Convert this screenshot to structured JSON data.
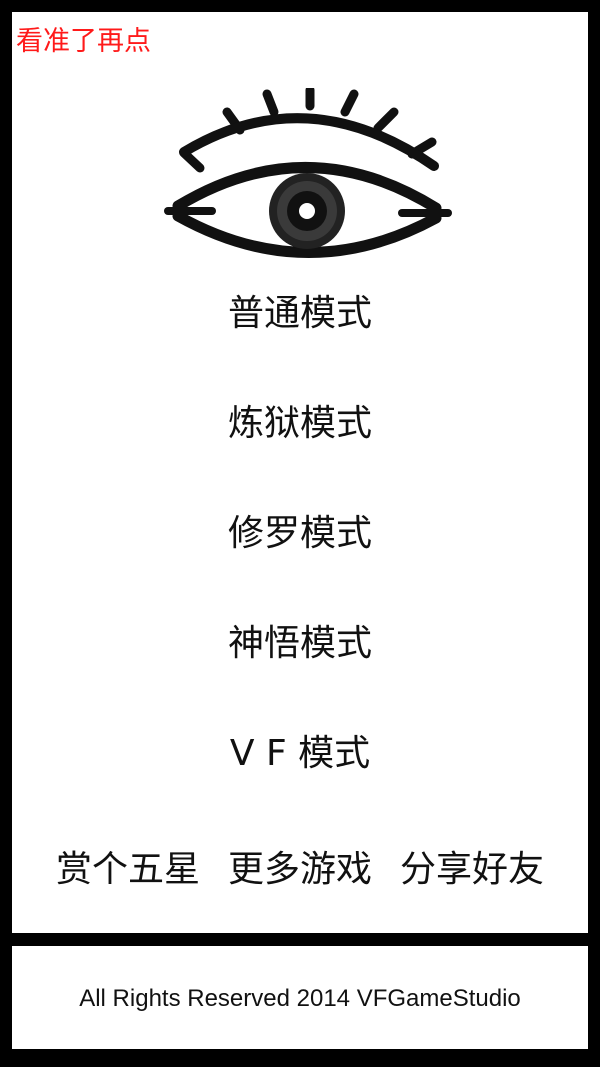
{
  "app": {
    "title": "看准了再点"
  },
  "logo": {
    "icon": "eye-icon"
  },
  "modes": [
    {
      "label": "普通模式"
    },
    {
      "label": "炼狱模式"
    },
    {
      "label": "修罗模式"
    },
    {
      "label": "神悟模式"
    },
    {
      "label": "V F 模式"
    }
  ],
  "links": {
    "rate": "赏个五星",
    "more_games": "更多游戏",
    "share": "分享好友"
  },
  "footer": {
    "copyright": "All Rights Reserved 2014 VFGameStudio"
  },
  "colors": {
    "title": "#ff1a1a",
    "background": "#ffffff",
    "frame": "#000000",
    "text": "#111111"
  }
}
